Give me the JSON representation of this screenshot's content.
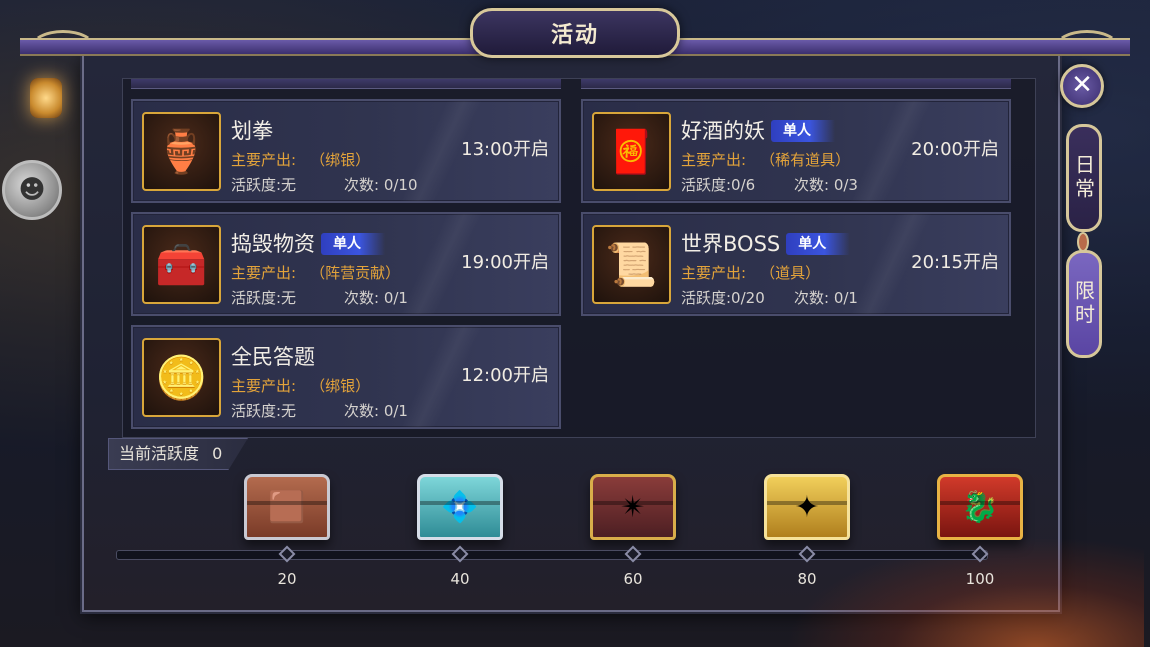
{
  "window": {
    "title": "活动"
  },
  "activities": [
    {
      "name": "划拳",
      "solo": "",
      "output_label": "主要产出:",
      "output_value": "（绑银）",
      "activity": "活跃度:无",
      "count": "次数: 0/10",
      "time": "13:00开启",
      "icon": "golden-teapot-icon",
      "icon_glyph": "🏺"
    },
    {
      "name": "好酒的妖",
      "solo": "单人",
      "output_label": "主要产出:",
      "output_value": "（稀有道具）",
      "activity": "活跃度:0/6",
      "count": "次数: 0/3",
      "time": "20:00开启",
      "icon": "fortune-bag-icon",
      "icon_glyph": "🧧"
    },
    {
      "name": "捣毁物资",
      "solo": "单人",
      "output_label": "主要产出:",
      "output_value": "（阵营贡献）",
      "activity": "活跃度:无",
      "count": "次数: 0/1",
      "time": "19:00开启",
      "icon": "supply-crate-icon",
      "icon_glyph": "🧰"
    },
    {
      "name": "世界BOSS",
      "solo": "单人",
      "output_label": "主要产出:",
      "output_value": "（道具）",
      "activity": "活跃度:0/20",
      "count": "次数: 0/1",
      "time": "20:15开启",
      "icon": "scroll-map-icon",
      "icon_glyph": "📜"
    },
    {
      "name": "全民答题",
      "solo": "",
      "output_label": "主要产出:",
      "output_value": "（绑银）",
      "activity": "活跃度:无",
      "count": "次数: 0/1",
      "time": "12:00开启",
      "icon": "silver-coin-icon",
      "icon_glyph": "🪙"
    }
  ],
  "progress": {
    "label": "当前活跃度",
    "value": "0",
    "fill_fraction": 0,
    "milestones": [
      {
        "value": "20",
        "chest": "copper-chest-icon",
        "glyph": "🟫"
      },
      {
        "value": "40",
        "chest": "jade-chest-icon",
        "glyph": "💠"
      },
      {
        "value": "60",
        "chest": "bronze-chest-icon",
        "glyph": "✴"
      },
      {
        "value": "80",
        "chest": "gold-chest-icon",
        "glyph": "✦"
      },
      {
        "value": "100",
        "chest": "dragon-chest-icon",
        "glyph": "🐉"
      }
    ]
  },
  "side_tabs": {
    "close": "✕",
    "daily": "日常",
    "limited": "限时"
  },
  "colors": {
    "output_orange": "#e3a33a",
    "solo_blue": "#3b55e0",
    "frame_gold": "#d6c79a",
    "tab_purple": "#7a67c0"
  }
}
